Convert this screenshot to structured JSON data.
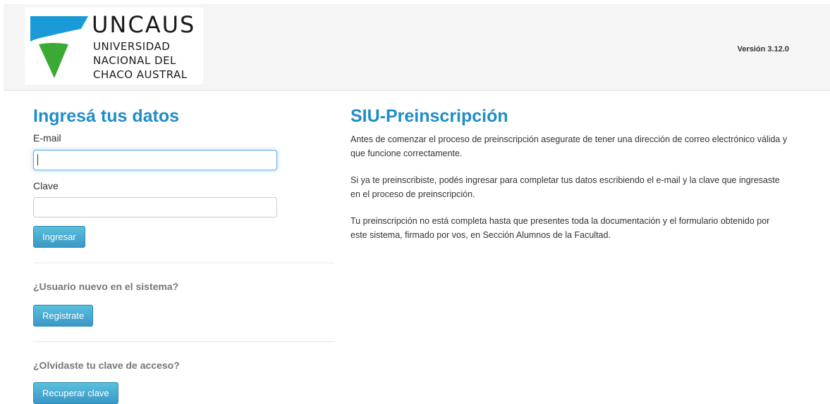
{
  "header": {
    "logo": {
      "title": "UNCAUS",
      "lines": [
        "UNIVERSIDAD",
        "NACIONAL DEL",
        "CHACO AUSTRAL"
      ],
      "colors": {
        "blue": "#1a9ad6",
        "green": "#3aaa35"
      }
    },
    "version": "Versión 3.12.0"
  },
  "login": {
    "heading": "Ingresá tus datos",
    "email_label": "E-mail",
    "email_value": "",
    "password_label": "Clave",
    "password_value": "",
    "submit_label": "Ingresar",
    "new_user_question": "¿Usuario nuevo en el sistema?",
    "register_label": "Registrate",
    "forgot_question": "¿Olvidaste tu clave de acceso?",
    "recover_label": "Recuperar clave"
  },
  "info": {
    "heading": "SIU-Preinscripción",
    "paragraphs": [
      "Antes de comenzar el proceso de preinscripción asegurate de tener una dirección de correo electrónico válida y que funcione correctamente.",
      "Si ya te preinscribiste, podés ingresar para completar tus datos escribiendo el e-mail y la clave que ingresaste en el proceso de preinscripción.",
      "Tu preinscripción no está completa hasta que presentes toda la documentación y el formulario obtenido por este sistema, firmado por vos, en Sección Alumnos de la Facultad."
    ]
  },
  "colors": {
    "accent": "#1f8dc7",
    "button": "#3a98c6",
    "header_bg": "#f5f5f5"
  }
}
